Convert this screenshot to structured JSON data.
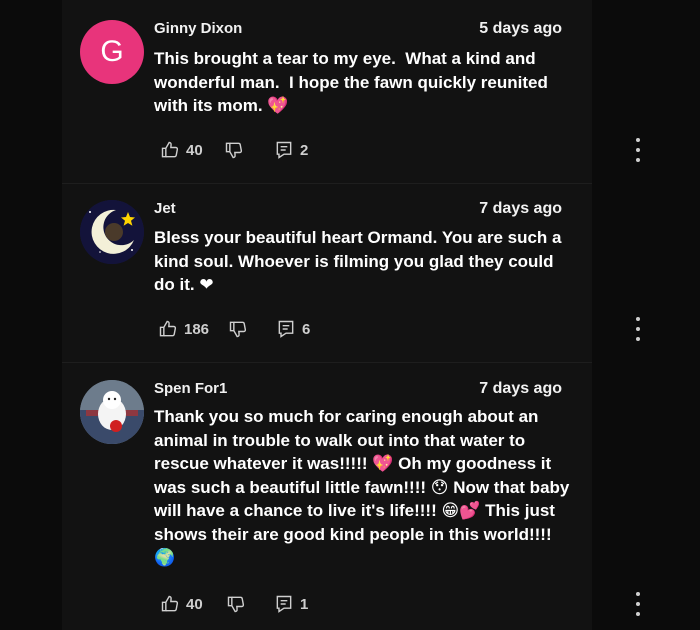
{
  "comments": [
    {
      "author": "Ginny Dixon",
      "time": "5 days ago",
      "avatar_letter": "G",
      "text": "This brought a tear to my eye.  What a kind and wonderful man.  I hope the fawn quickly reunited with its mom. 💖",
      "likes": "40",
      "replies": "2"
    },
    {
      "author": "Jet",
      "time": "7 days ago",
      "text": "Bless your beautiful heart Ormand. You are such a kind soul. Whoever is filming you glad they could do it. ❤",
      "likes": "186",
      "replies": "6"
    },
    {
      "author": "Spen For1",
      "time": "7 days ago",
      "text": "Thank you so much for caring enough about an animal in trouble to walk out into that water to rescue whatever it was!!!!! 💖 Oh my goodness it was such a beautiful little fawn!!!! 😯 Now that baby will have a chance to live it's life!!!! 😁💕 This just shows their are good kind people in this world!!!!  🌍",
      "likes": "40",
      "replies": "1"
    }
  ],
  "icons": {
    "like": "thumb-up-icon",
    "dislike": "thumb-down-icon",
    "reply": "reply-comment-icon",
    "more": "more-vertical-icon"
  },
  "colors": {
    "avatar_g": "#e8347b",
    "background": "#121212"
  }
}
